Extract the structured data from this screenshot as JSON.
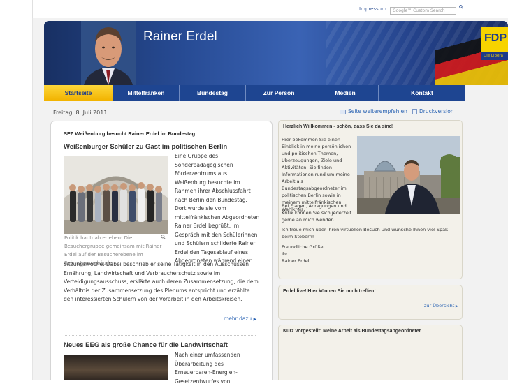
{
  "top": {
    "impressum": "Impressum",
    "search_placeholder": "Google™ Custom Search"
  },
  "header": {
    "title": "Rainer Erdel",
    "party_logo": "FDP",
    "party_sub": "Die Libera"
  },
  "nav": {
    "items": [
      "Startseite",
      "Mittelfranken",
      "Bundestag",
      "Zur Person",
      "Medien",
      "Kontakt"
    ],
    "active": "Startseite"
  },
  "toolbar": {
    "date": "Freitag, 8. Juli 2011",
    "recommend": "Seite weiterempfehlen",
    "print": "Druckversion"
  },
  "main": {
    "heading": "SFZ Weißenburg besucht Rainer Erdel im Bundestag",
    "article1": {
      "title": "Weißenburger Schüler zu Gast im politischen Berlin",
      "caption": "Politik hautnah erleben: Die Besuchergruppe gemeinsam mit Rainer Erdel auf der Besucherebene im Reichstagsgebäude",
      "column_text": "Eine Gruppe des Sonderpädagogischen Förderzentrums aus Weißenburg besuchte im Rahmen ihrer Abschlussfahrt nach Berlin den Bundestag. Dort wurde sie vom mittelfränkischen Abgeordneten Rainer Erdel begrüßt. Im Gespräch mit den Schülerinnen und Schülern schilderte Rainer Erdel den Tagesablauf eines Abgeordneten während einer",
      "full_text": "Sitzungswoche. Dabei beschrieb er seine Tätigkeit in den Ausschüssen Ernährung, Landwirtschaft und Verbraucherschutz sowie im Verteidigungsausschuss, erklärte auch deren Zusammensetzung, die dem Verhältnis der Zusammensetzung des Plenums entspricht und erzählte den interessierten Schülern von der Vorarbeit in den Arbeitskreisen.",
      "more": "mehr dazu"
    },
    "article2": {
      "title": "Neues EEG als große Chance für die Landwirtschaft",
      "column_text": "Nach einer umfassenden Überarbeitung des Erneuerbaren-Energien-Gesetzentwurfes von"
    }
  },
  "sidebar": {
    "welcome": {
      "heading": "Herzlich Willkommen - schön, dass Sie da sind!",
      "intro": "Hier bekommen Sie einen Einblick in meine persönlichen und politischen Themen, Überzeugungen, Ziele und Aktivitäten. Sie finden Informationen rund um meine Arbeit als Bundestagsabgeordneter im politischen Berlin sowie in meinem mittelfränkischen Wahlkreis.",
      "feedback": "Bei Fragen, Anregungen und Kritik können Sie sich jederzeit gerne an mich wenden.",
      "closing": "Ich freue mich über Ihren virtuellen Besuch und wünsche Ihnen viel Spaß beim Stöbern!",
      "greeting": "Freundliche Grüße",
      "ihr": "Ihr",
      "signature": "Rainer Erdel"
    },
    "live": {
      "heading": "Erdel live! Hier können Sie mich treffen!",
      "link": "zur Übersicht"
    },
    "intro_box": {
      "heading": "Kurz vorgestellt: Meine Arbeit als Bundestagsabgeordneter"
    }
  },
  "colors": {
    "nav_bg": "#1e4591",
    "nav_active": "#f2b300",
    "link": "#2a63b3",
    "fdp_yellow": "#f7d300"
  }
}
